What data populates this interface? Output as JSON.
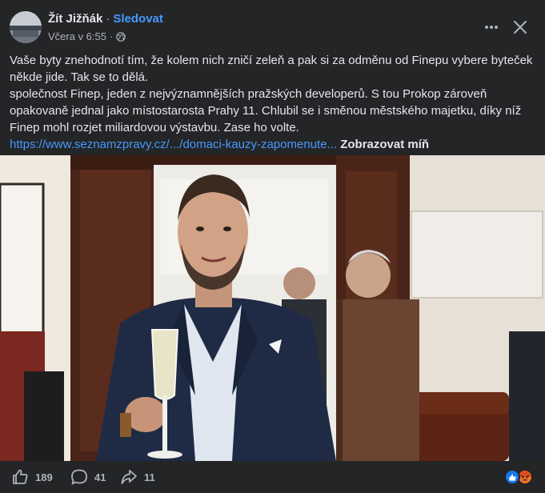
{
  "post": {
    "author": "Žít Jižňák",
    "separator": "·",
    "follow_label": "Sledovat",
    "timestamp": "Včera v 6:55",
    "meta_dot": "·",
    "privacy_icon": "globe-icon",
    "text_lines": [
      "Vaše byty znehodnotí tím, že kolem nich zničí zeleň a pak si za odměnu od Finepu vybere byteček",
      "někde jide. Tak se to dělá.",
      "společnost Finep, jeden z nejvýznamnějších pražských developerů. S tou Prokop zároveň",
      "opakovaně jednal jako místostarosta Prahy 11. Chlubil se i směnou městského majetku, díky níž",
      "Finep mohl rozjet miliardovou výstavbu. Zase ho volte."
    ],
    "link_text": "https://www.seznamzpravy.cz/.../domaci-kauzy-zapomenute...",
    "see_less_label": "Zobrazovat míň"
  },
  "footer": {
    "like_count": "189",
    "comment_count": "41",
    "share_count": "11",
    "reactions": [
      "like-reaction-icon",
      "angry-reaction-icon"
    ]
  },
  "colors": {
    "background": "#242526",
    "text": "#e4e6eb",
    "muted": "#b0b3b8",
    "link": "#4599ff",
    "like_blue": "#1877f2",
    "angry_orange": "#e9710f"
  }
}
